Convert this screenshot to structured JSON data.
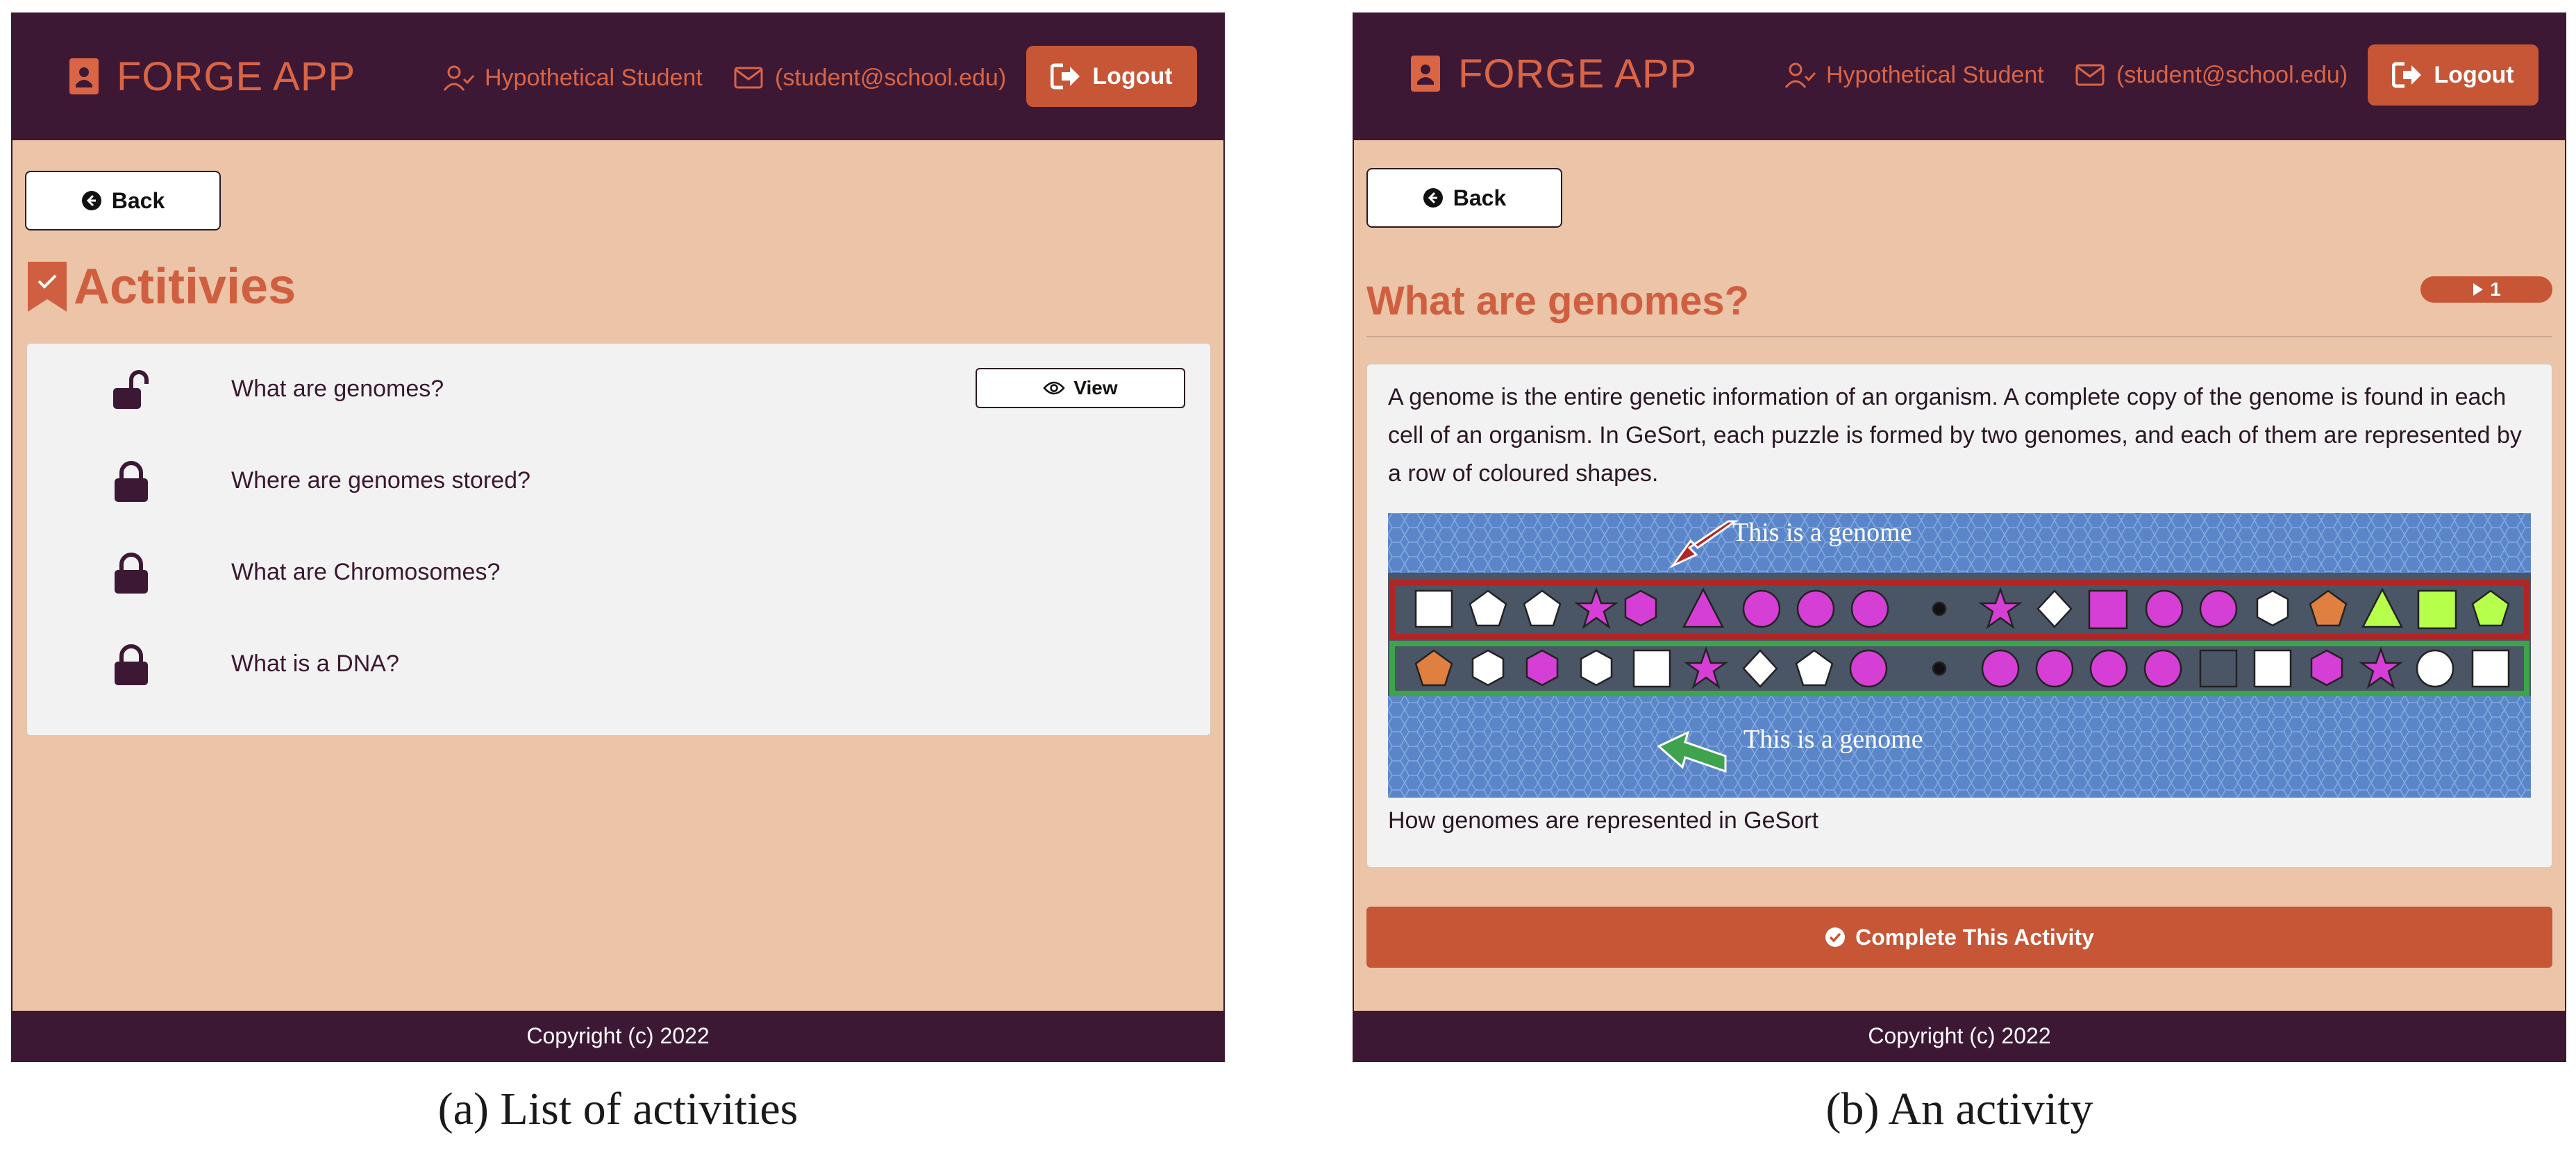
{
  "panels": [
    {
      "brand": "FORGE APP",
      "user_name": "Hypothetical Student",
      "user_email": "(student@school.edu)",
      "logout_label": "Logout",
      "back_label": "Back",
      "page_title": "Actitivies",
      "activities": [
        {
          "label": "What are genomes?",
          "locked": false,
          "action": "View"
        },
        {
          "label": "Where are genomes stored?",
          "locked": true
        },
        {
          "label": "What are Chromosomes?",
          "locked": true
        },
        {
          "label": "What is a DNA?",
          "locked": true
        }
      ],
      "footer": "Copyright (c) 2022"
    },
    {
      "brand": "FORGE APP",
      "user_name": "Hypothetical Student",
      "user_email": "(student@school.edu)",
      "logout_label": "Logout",
      "back_label": "Back",
      "page_title": "What are genomes?",
      "step_badge": "1",
      "body": "A genome is the entire genetic information of an organism. A complete copy of the genome is found in each cell of an organism. In GeSort, each puzzle is formed by two genomes, and each of them are represented by a row of coloured shapes.",
      "image_labels": [
        "This is a genome",
        "This is a genome"
      ],
      "image_caption": "How genomes are represented in GeSort",
      "complete_label": "Complete This Activity",
      "footer": "Copyright (c) 2022"
    }
  ],
  "captions": [
    "(a) List of activities",
    "(b) An activity"
  ],
  "colors": {
    "header_bg": "#3d1834",
    "page_bg": "#ecc5a9",
    "accent": "#c65636",
    "accent_text": "#d96545",
    "card_bg": "#f2f2f2"
  },
  "icons": {
    "brand": "contact-book-icon",
    "user": "user-check-icon",
    "email": "mail-check-icon",
    "logout": "logout-icon",
    "back": "arrow-circle-left-icon",
    "page_title": "bookmark-check-icon",
    "unlocked": "lock-open-icon",
    "locked": "lock-icon",
    "view": "eye-icon",
    "step": "play-icon",
    "complete": "check-circle-icon"
  }
}
